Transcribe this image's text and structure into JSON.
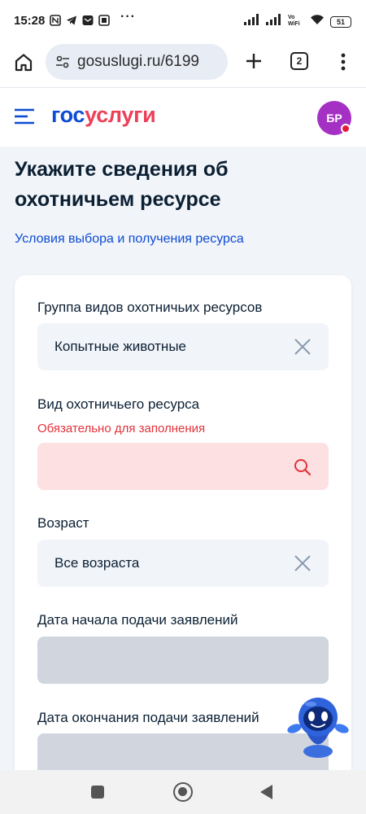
{
  "status_bar": {
    "time": "15:28",
    "battery": "51",
    "more": "···"
  },
  "browser": {
    "url": "gosuslugi.ru/6199",
    "tab_count": "2"
  },
  "header": {
    "logo_part1": "гос",
    "logo_part2": "услуги",
    "avatar_initials": "БР"
  },
  "page": {
    "title": "Укажите сведения об охотничьем ресурсе",
    "conditions_link": "Условия выбора и получения ресурса"
  },
  "form": {
    "group": {
      "label": "Группа видов охотничьих ресурсов",
      "value": "Копытные животные"
    },
    "resource_type": {
      "label": "Вид охотничьего ресурса",
      "error": "Обязательно для заполнения",
      "value": ""
    },
    "age": {
      "label": "Возраст",
      "value": "Все возраста"
    },
    "start_date": {
      "label": "Дата начала подачи заявлений"
    },
    "end_date": {
      "label": "Дата окончания подачи заявлений"
    }
  },
  "colors": {
    "brand_blue": "#0d4cd3",
    "brand_red": "#ee3f58",
    "error": "#e1323a",
    "avatar": "#a431c4"
  }
}
